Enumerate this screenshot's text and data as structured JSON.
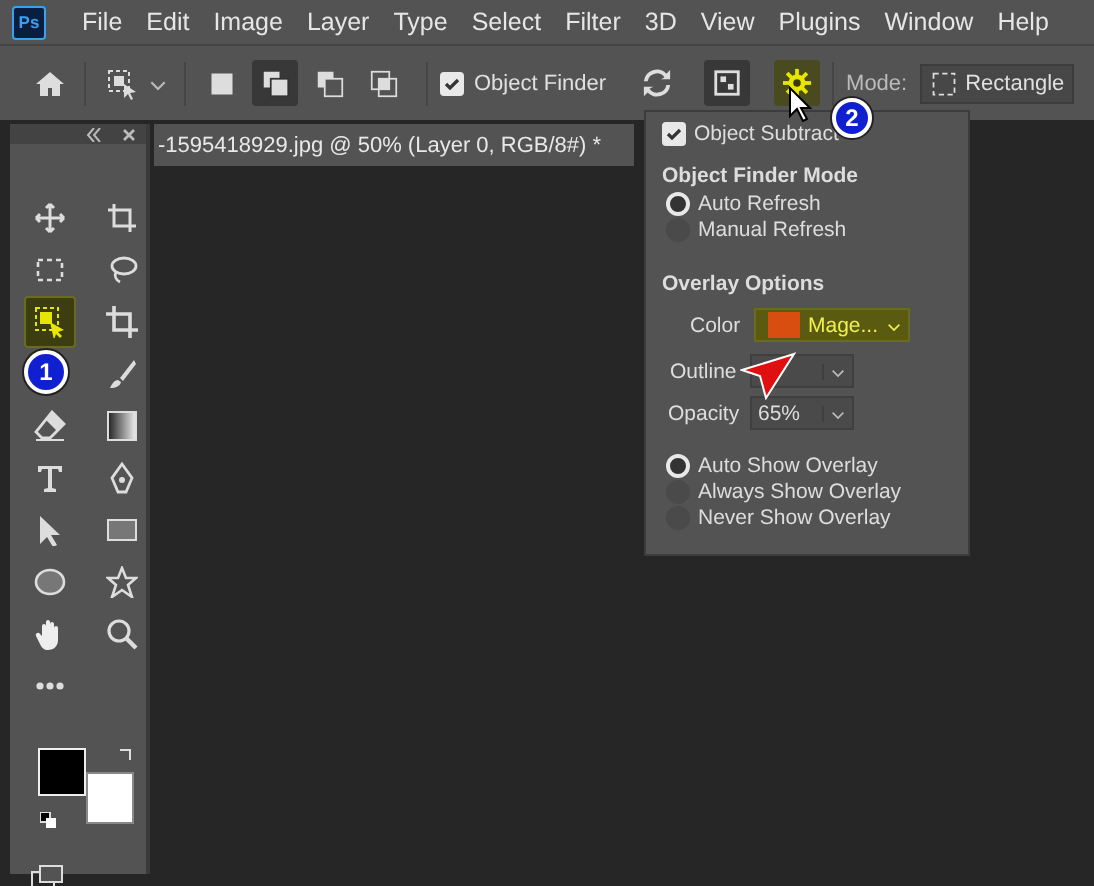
{
  "app_logo": "Ps",
  "menu_bar": {
    "items": [
      "File",
      "Edit",
      "Image",
      "Layer",
      "Type",
      "Select",
      "Filter",
      "3D",
      "View",
      "Plugins",
      "Window",
      "Help"
    ]
  },
  "options_bar": {
    "selection_modes": [
      {
        "kind": "new",
        "selected": false
      },
      {
        "kind": "add",
        "selected": true
      },
      {
        "kind": "subtract",
        "selected": false
      },
      {
        "kind": "intersect",
        "selected": false
      }
    ],
    "object_finder": {
      "label": "Object Finder",
      "checked": true
    },
    "show_all_objects": {
      "on": true
    },
    "settings": {
      "open": true
    },
    "mode": {
      "label": "Mode:",
      "value": "Rectangle"
    }
  },
  "document_tab": {
    "title": "-1595418929.jpg @ 50% (Layer 0, RGB/8#) *"
  },
  "tools": [
    {
      "kind": "move",
      "selected": false
    },
    {
      "kind": "artboard",
      "selected": false
    },
    {
      "kind": "marquee",
      "selected": false
    },
    {
      "kind": "lasso",
      "selected": false
    },
    {
      "kind": "object-select",
      "selected": true
    },
    {
      "kind": "crop",
      "selected": false
    },
    {
      "kind": "brush",
      "selected": false
    },
    {
      "kind": "eraser",
      "selected": false
    },
    {
      "kind": "gradient",
      "selected": false
    },
    {
      "kind": "type",
      "selected": false
    },
    {
      "kind": "pen",
      "selected": false
    },
    {
      "kind": "path-select",
      "selected": false
    },
    {
      "kind": "rectangle",
      "selected": false
    },
    {
      "kind": "ellipse",
      "selected": false
    },
    {
      "kind": "shape",
      "selected": false
    },
    {
      "kind": "hand",
      "selected": false
    },
    {
      "kind": "zoom",
      "selected": false
    },
    {
      "kind": "more",
      "selected": false
    }
  ],
  "swatches": [
    {
      "kind": "foreground",
      "color": "#000000"
    },
    {
      "kind": "background",
      "color": "#ffffff"
    }
  ],
  "settings_popup": {
    "object_subtract": {
      "label": "Object Subtract",
      "checked": true
    },
    "finder_mode": {
      "title": "Object Finder Mode",
      "options": [
        {
          "label": "Auto Refresh",
          "selected": true
        },
        {
          "label": "Manual Refresh",
          "selected": false
        }
      ]
    },
    "overlay_options": {
      "title": "Overlay Options",
      "color": {
        "label": "Color",
        "value": "Mage...",
        "color": "#d84e10"
      },
      "outline": {
        "label": "Outline"
      },
      "opacity": {
        "label": "Opacity",
        "value": "65%"
      }
    },
    "show_overlay": [
      {
        "label": "Auto Show Overlay",
        "selected": true
      },
      {
        "label": "Always Show Overlay",
        "selected": false
      },
      {
        "label": "Never Show Overlay",
        "selected": false
      }
    ]
  },
  "callouts": [
    {
      "label": "1"
    },
    {
      "label": "2"
    }
  ]
}
